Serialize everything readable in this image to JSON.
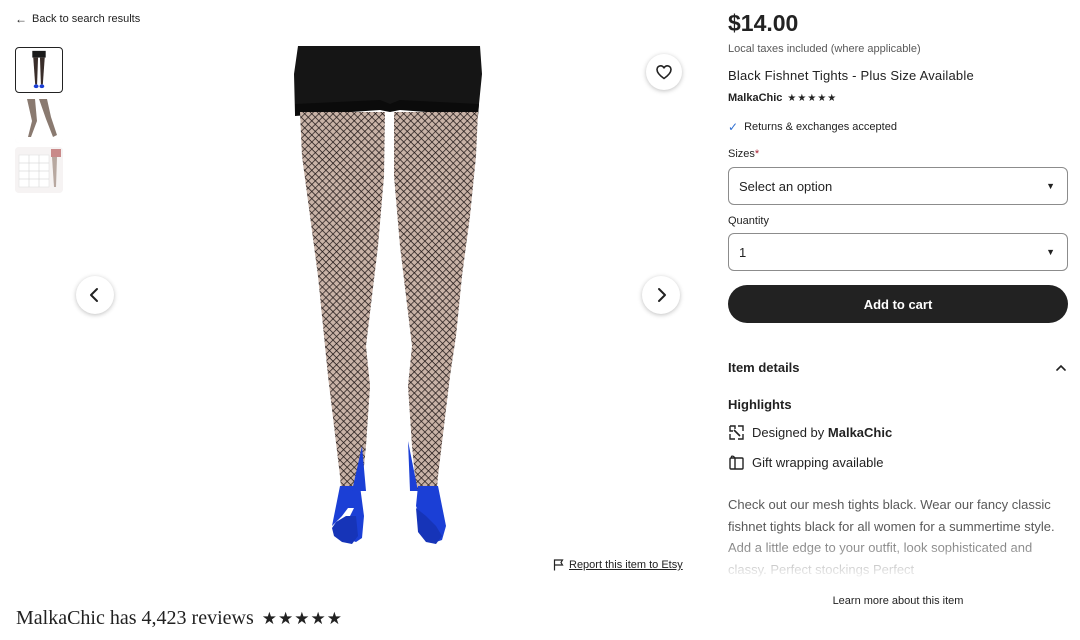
{
  "nav": {
    "back_label": "Back to search results"
  },
  "gallery": {
    "thumbnails": [
      "thumbnail-1",
      "thumbnail-2",
      "thumbnail-3"
    ],
    "icons": {
      "prev": "chevron-left-icon",
      "next": "chevron-right-icon",
      "favorite": "heart-icon"
    }
  },
  "report": {
    "label": "Report this item to Etsy"
  },
  "reviews": {
    "heading": "MalkaChic has 4,423 reviews",
    "stars": "★★★★★"
  },
  "product": {
    "price": "$14.00",
    "tax_note": "Local taxes included (where applicable)",
    "title": "Black Fishnet Tights - Plus Size Available",
    "shop_name": "MalkaChic",
    "shop_stars": "★★★★★",
    "returns": "Returns & exchanges accepted"
  },
  "form": {
    "sizes_label": "Sizes",
    "sizes_required": "*",
    "sizes_value": "Select an option",
    "quantity_label": "Quantity",
    "quantity_value": "1",
    "add_to_cart": "Add to cart"
  },
  "details": {
    "header": "Item details",
    "highlights_title": "Highlights",
    "designed_by_prefix": "Designed by",
    "designed_by_shop": "MalkaChic",
    "gift_wrapping": "Gift wrapping available",
    "description": "Check out our mesh tights black. Wear our fancy classic fishnet tights black for all women for a summertime style. Add a little edge to your outfit, look sophisticated and classy. Perfect stockings Perfect",
    "learn_more": "Learn more about this item"
  },
  "colors": {
    "accent_dark": "#222222",
    "check_blue": "#2f6fd1",
    "required_red": "#a61a2e",
    "shoe_blue": "#1b3fd6"
  }
}
